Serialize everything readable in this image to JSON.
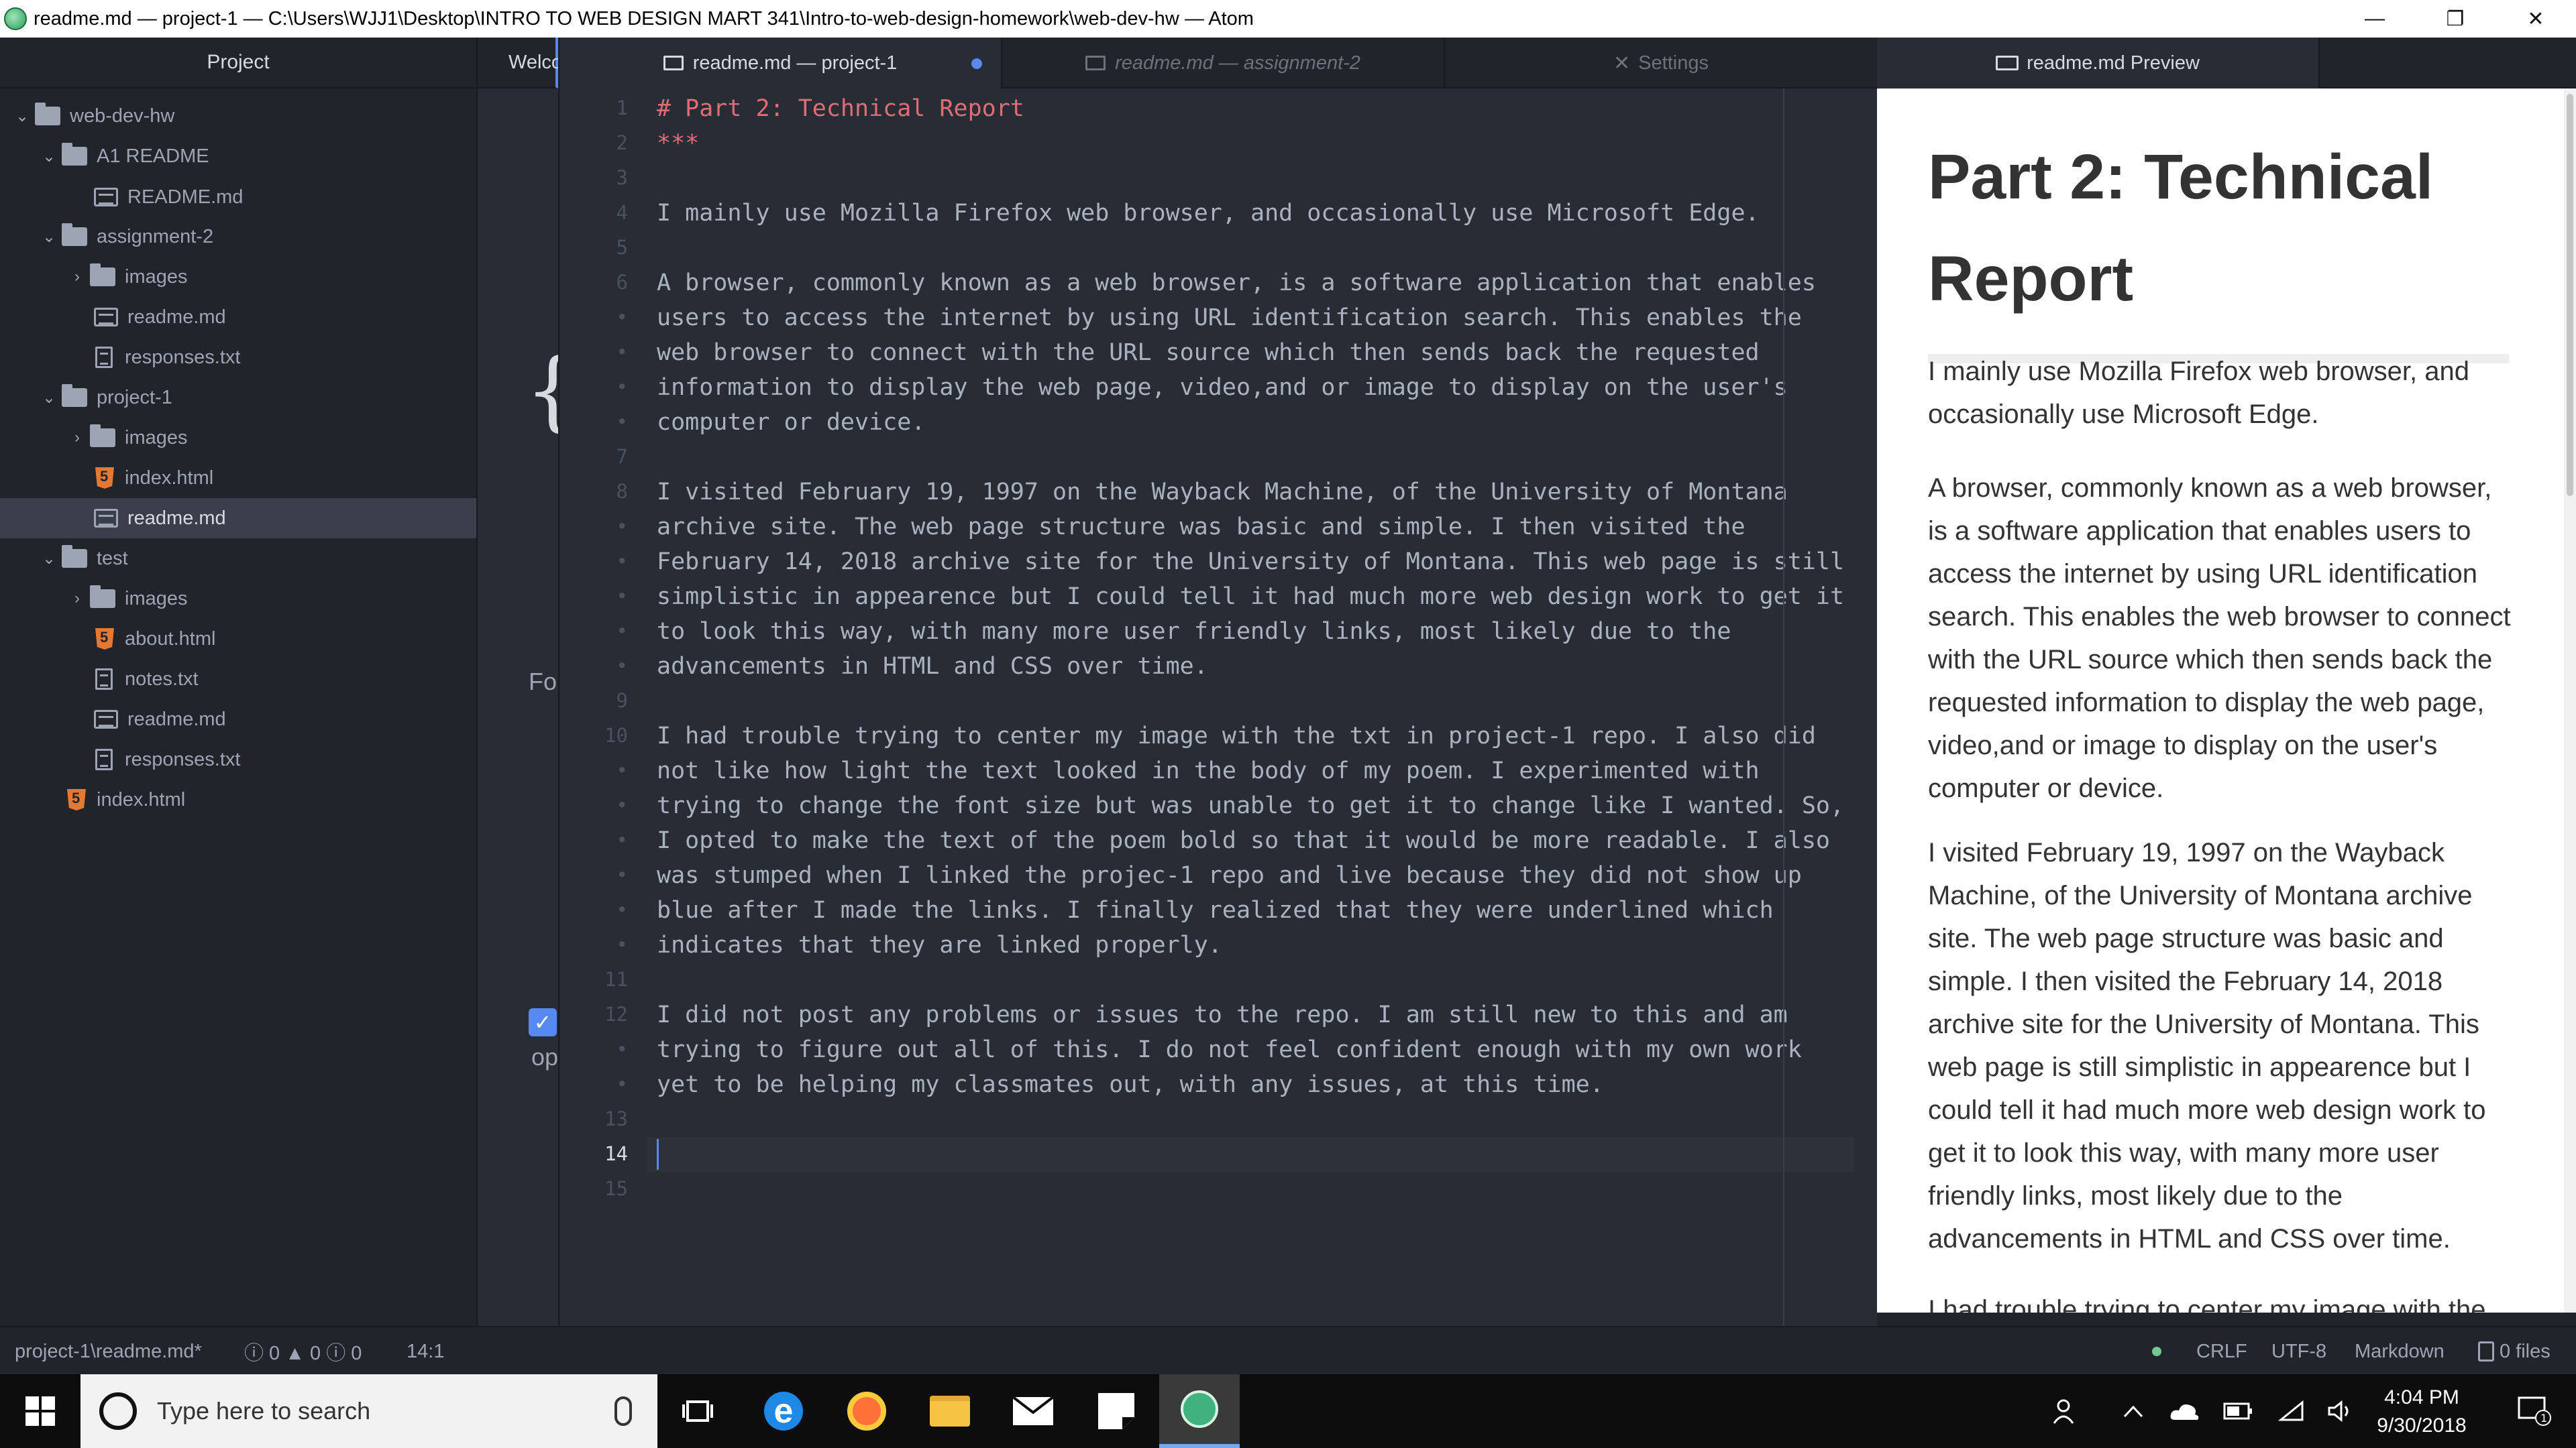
{
  "window": {
    "title": "readme.md — project-1 — C:\\Users\\WJJ1\\Desktop\\INTRO TO WEB DESIGN MART 341\\Intro-to-web-design-homework\\web-dev-hw — Atom",
    "minimize_glyph": "—",
    "maximize_glyph": "❐",
    "close_glyph": "✕"
  },
  "tree": {
    "panel_title": "Project",
    "items": [
      {
        "label": "web-dev-hw",
        "type": "folder"
      },
      {
        "label": "A1 README",
        "type": "folder"
      },
      {
        "label": "README.md",
        "type": "md"
      },
      {
        "label": "assignment-2",
        "type": "folder"
      },
      {
        "label": "images",
        "type": "folder"
      },
      {
        "label": "readme.md",
        "type": "md"
      },
      {
        "label": "responses.txt",
        "type": "txt"
      },
      {
        "label": "project-1",
        "type": "folder"
      },
      {
        "label": "images",
        "type": "folder"
      },
      {
        "label": "index.html",
        "type": "html"
      },
      {
        "label": "readme.md",
        "type": "md",
        "selected": true
      },
      {
        "label": "test",
        "type": "folder"
      },
      {
        "label": "images",
        "type": "folder"
      },
      {
        "label": "about.html",
        "type": "html"
      },
      {
        "label": "notes.txt",
        "type": "txt"
      },
      {
        "label": "readme.md",
        "type": "md"
      },
      {
        "label": "responses.txt",
        "type": "txt"
      },
      {
        "label": "index.html",
        "type": "html"
      }
    ]
  },
  "welcome_pane": {
    "tab_label": "Welcome",
    "brace": "{",
    "fo_text": "Fo",
    "check_glyph": "✓",
    "op_text": "op"
  },
  "tabs": [
    {
      "label": "readme.md — project-1",
      "state": "active",
      "modified": true
    },
    {
      "label": "readme.md — assignment-2",
      "state": "pending"
    },
    {
      "label": "Settings",
      "state": "inactive",
      "icon": "tools-icon",
      "icon_glyph": "✕"
    }
  ],
  "editor": {
    "current_line": 14,
    "lines": [
      {
        "n": "1",
        "rows": [
          "# Part 2: Technical Report"
        ],
        "heading": true
      },
      {
        "n": "2",
        "rows": [
          "***"
        ],
        "heading": true
      },
      {
        "n": "3",
        "rows": [
          ""
        ]
      },
      {
        "n": "4",
        "rows": [
          "I mainly use Mozilla Firefox web browser, and occasionally use Microsoft Edge."
        ]
      },
      {
        "n": "5",
        "rows": [
          ""
        ]
      },
      {
        "n": "6",
        "rows": [
          "A browser, commonly known as a web browser, is a software application that enables",
          "users to access the internet by using URL identification search. This enables the",
          "web browser to connect with the URL source which then sends back the requested",
          "information to display the web page, video,and or image to display on the user's",
          "computer or device."
        ]
      },
      {
        "n": "7",
        "rows": [
          ""
        ]
      },
      {
        "n": "8",
        "rows": [
          "I visited February 19, 1997 on the Wayback Machine, of the University of Montana",
          "archive site. The web page structure was basic and simple. I then visited the",
          "February 14, 2018 archive site for the University of Montana. This web page is still",
          "simplistic in appearence but I could tell it had much more web design work to get it",
          "to look this way, with many more user friendly links, most likely due to the",
          "advancements in HTML and CSS over time."
        ]
      },
      {
        "n": "9",
        "rows": [
          ""
        ]
      },
      {
        "n": "10",
        "rows": [
          "I had trouble trying to center my image with the txt in project-1 repo. I also did",
          "not like how light the text looked in the body of my poem. I experimented with",
          "trying to change the font size but was unable to get it to change like I wanted. So,",
          "I opted to make the text of the poem bold so that it would be more readable. I also",
          "was stumped when I linked the projec-1 repo and live because they did not show up",
          "blue after I made the links. I finally realized that they were underlined which",
          "indicates that they are linked properly."
        ]
      },
      {
        "n": "11",
        "rows": [
          ""
        ]
      },
      {
        "n": "12",
        "rows": [
          "I did not post any problems or issues to the repo. I am still new to this and am",
          "trying to figure out all of this. I do not feel confident enough with my own work",
          "yet to be helping my classmates out, with any issues, at this time."
        ]
      },
      {
        "n": "13",
        "rows": [
          ""
        ]
      },
      {
        "n": "14",
        "rows": [
          ""
        ]
      },
      {
        "n": "15",
        "rows": [
          ""
        ]
      }
    ]
  },
  "preview": {
    "tab_label": "readme.md Preview",
    "title": "Part 2: Technical Report",
    "paragraphs": [
      "I mainly use Mozilla Firefox web browser, and occasionally use Microsoft Edge.",
      "A browser, commonly known as a web browser, is a software application that enables users to access the internet by using URL identification search. This enables the web browser to connect with the URL source which then sends back the requested information to display the web page, video,and or image to display on the user's computer or device.",
      "I visited February 19, 1997 on the Wayback Machine, of the University of Montana archive site. The web page structure was basic and simple. I then visited the February 14, 2018 archive site for the University of Montana. This web page is still simplistic in appearence but I could tell it had much more web design work to get it to look this way, with many more user friendly links, most likely due to the advancements in HTML and CSS over time.",
      "I had trouble trying to center my image with the"
    ]
  },
  "status": {
    "file_path": "project-1\\readme.md*",
    "diagnostics": "ⓘ 0 ▲ 0 ⓘ 0",
    "cursor_pos": "14:1",
    "line_ending": "CRLF",
    "encoding": "UTF-8",
    "grammar": "Markdown",
    "files": "0 files"
  },
  "taskbar": {
    "search_placeholder": "Type here to search",
    "time": "4:04 PM",
    "date": "9/30/2018",
    "notification_badge": "1",
    "colors": {
      "edge": "#1e88e5",
      "firefox": "#ff7139",
      "explorer": "#f6c343",
      "atom": "#3fb27f"
    }
  }
}
